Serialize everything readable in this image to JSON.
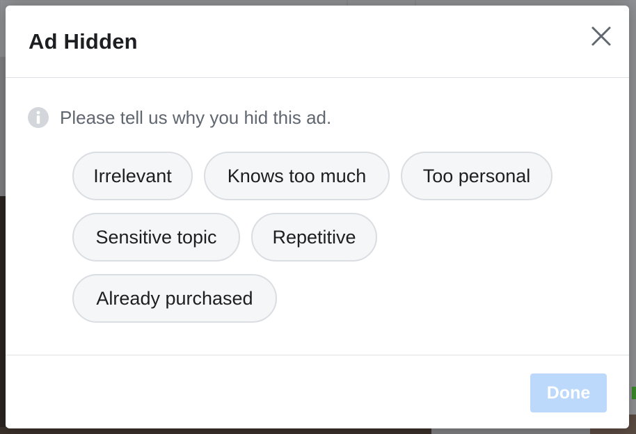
{
  "dialog": {
    "title": "Ad Hidden",
    "prompt": "Please tell us why you hid this ad.",
    "reasons": [
      "Irrelevant",
      "Knows too much",
      "Too personal",
      "Sensitive topic",
      "Repetitive",
      "Already purchased"
    ],
    "done_label": "Done",
    "icons": {
      "close": "close-icon",
      "info": "info-icon"
    }
  },
  "colors": {
    "title": "#1c1e21",
    "prompt": "#606770",
    "chip_bg": "#f5f6f7",
    "chip_border": "#dadde1",
    "done_disabled_bg": "#bcd8fb",
    "overlay": "#7f7f82"
  }
}
